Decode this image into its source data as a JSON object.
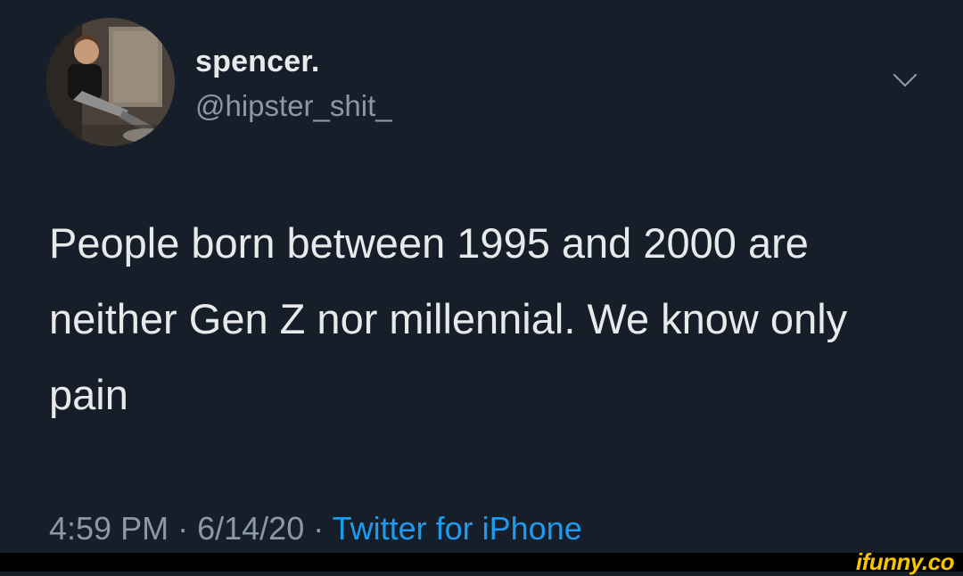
{
  "tweet": {
    "author": {
      "display_name": "spencer.",
      "handle": "@hipster_shit_"
    },
    "text": "People born between 1995 and 2000 are neither Gen Z nor millennial. We know only pain",
    "time": "4:59 PM",
    "separator": "·",
    "date": "6/14/20",
    "source": "Twitter for iPhone"
  },
  "icons": {
    "menu": "chevron-down-icon"
  },
  "watermark": {
    "text": "ifunny.co"
  },
  "colors": {
    "background": "#161e29",
    "primary_text": "#e7e9ea",
    "secondary_text": "#8b98a5",
    "accent": "#1d9bf0",
    "watermark": "#f6c400"
  }
}
